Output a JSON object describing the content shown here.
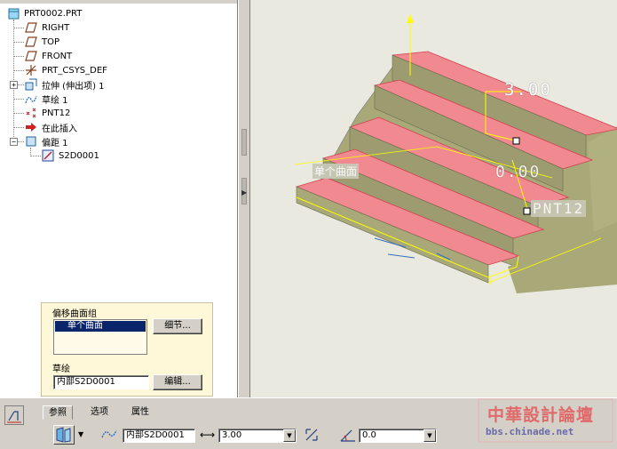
{
  "tree": {
    "items": [
      {
        "label": "PRT0002.PRT",
        "icon": "part-icon"
      },
      {
        "label": "RIGHT",
        "icon": "datum-plane-icon"
      },
      {
        "label": "TOP",
        "icon": "datum-plane-icon"
      },
      {
        "label": "FRONT",
        "icon": "datum-plane-icon"
      },
      {
        "label": "PRT_CSYS_DEF",
        "icon": "coordinate-system-icon"
      },
      {
        "label": "拉伸 (伸出项) 1",
        "icon": "extrude-icon"
      },
      {
        "label": "草绘 1",
        "icon": "sketch-icon"
      },
      {
        "label": "PNT12",
        "icon": "datum-point-icon"
      },
      {
        "label": "在此插入",
        "icon": "insert-here-arrow-icon"
      },
      {
        "label": "偏距 1",
        "icon": "offset-icon"
      },
      {
        "label": "S2D0001",
        "icon": "sketch-edit-icon"
      }
    ]
  },
  "viewport": {
    "dim_offset": "3.00",
    "dim_zero": "0.00",
    "point_label": "PNT12",
    "surface_label": "单个曲面",
    "colors": {
      "surface": "#f08a90",
      "solid": "#a8a878",
      "highlight": "#ffff00",
      "background": "#e9e9df"
    }
  },
  "ref_panel": {
    "group_label": "偏移曲面组",
    "selected_item": "单个曲面",
    "details_button": "细节...",
    "sketch_label": "草绘",
    "sketch_value": "内部S2D0001",
    "edit_button": "编辑..."
  },
  "dashboard": {
    "tabs": [
      "参照",
      "选项",
      "属性"
    ],
    "sketch_field": "内部S2D0001",
    "offset_value": "3.00",
    "angle_value": "0.0"
  },
  "watermark": {
    "title": "中華設計論壇",
    "url": "bbs.chinade.net"
  }
}
